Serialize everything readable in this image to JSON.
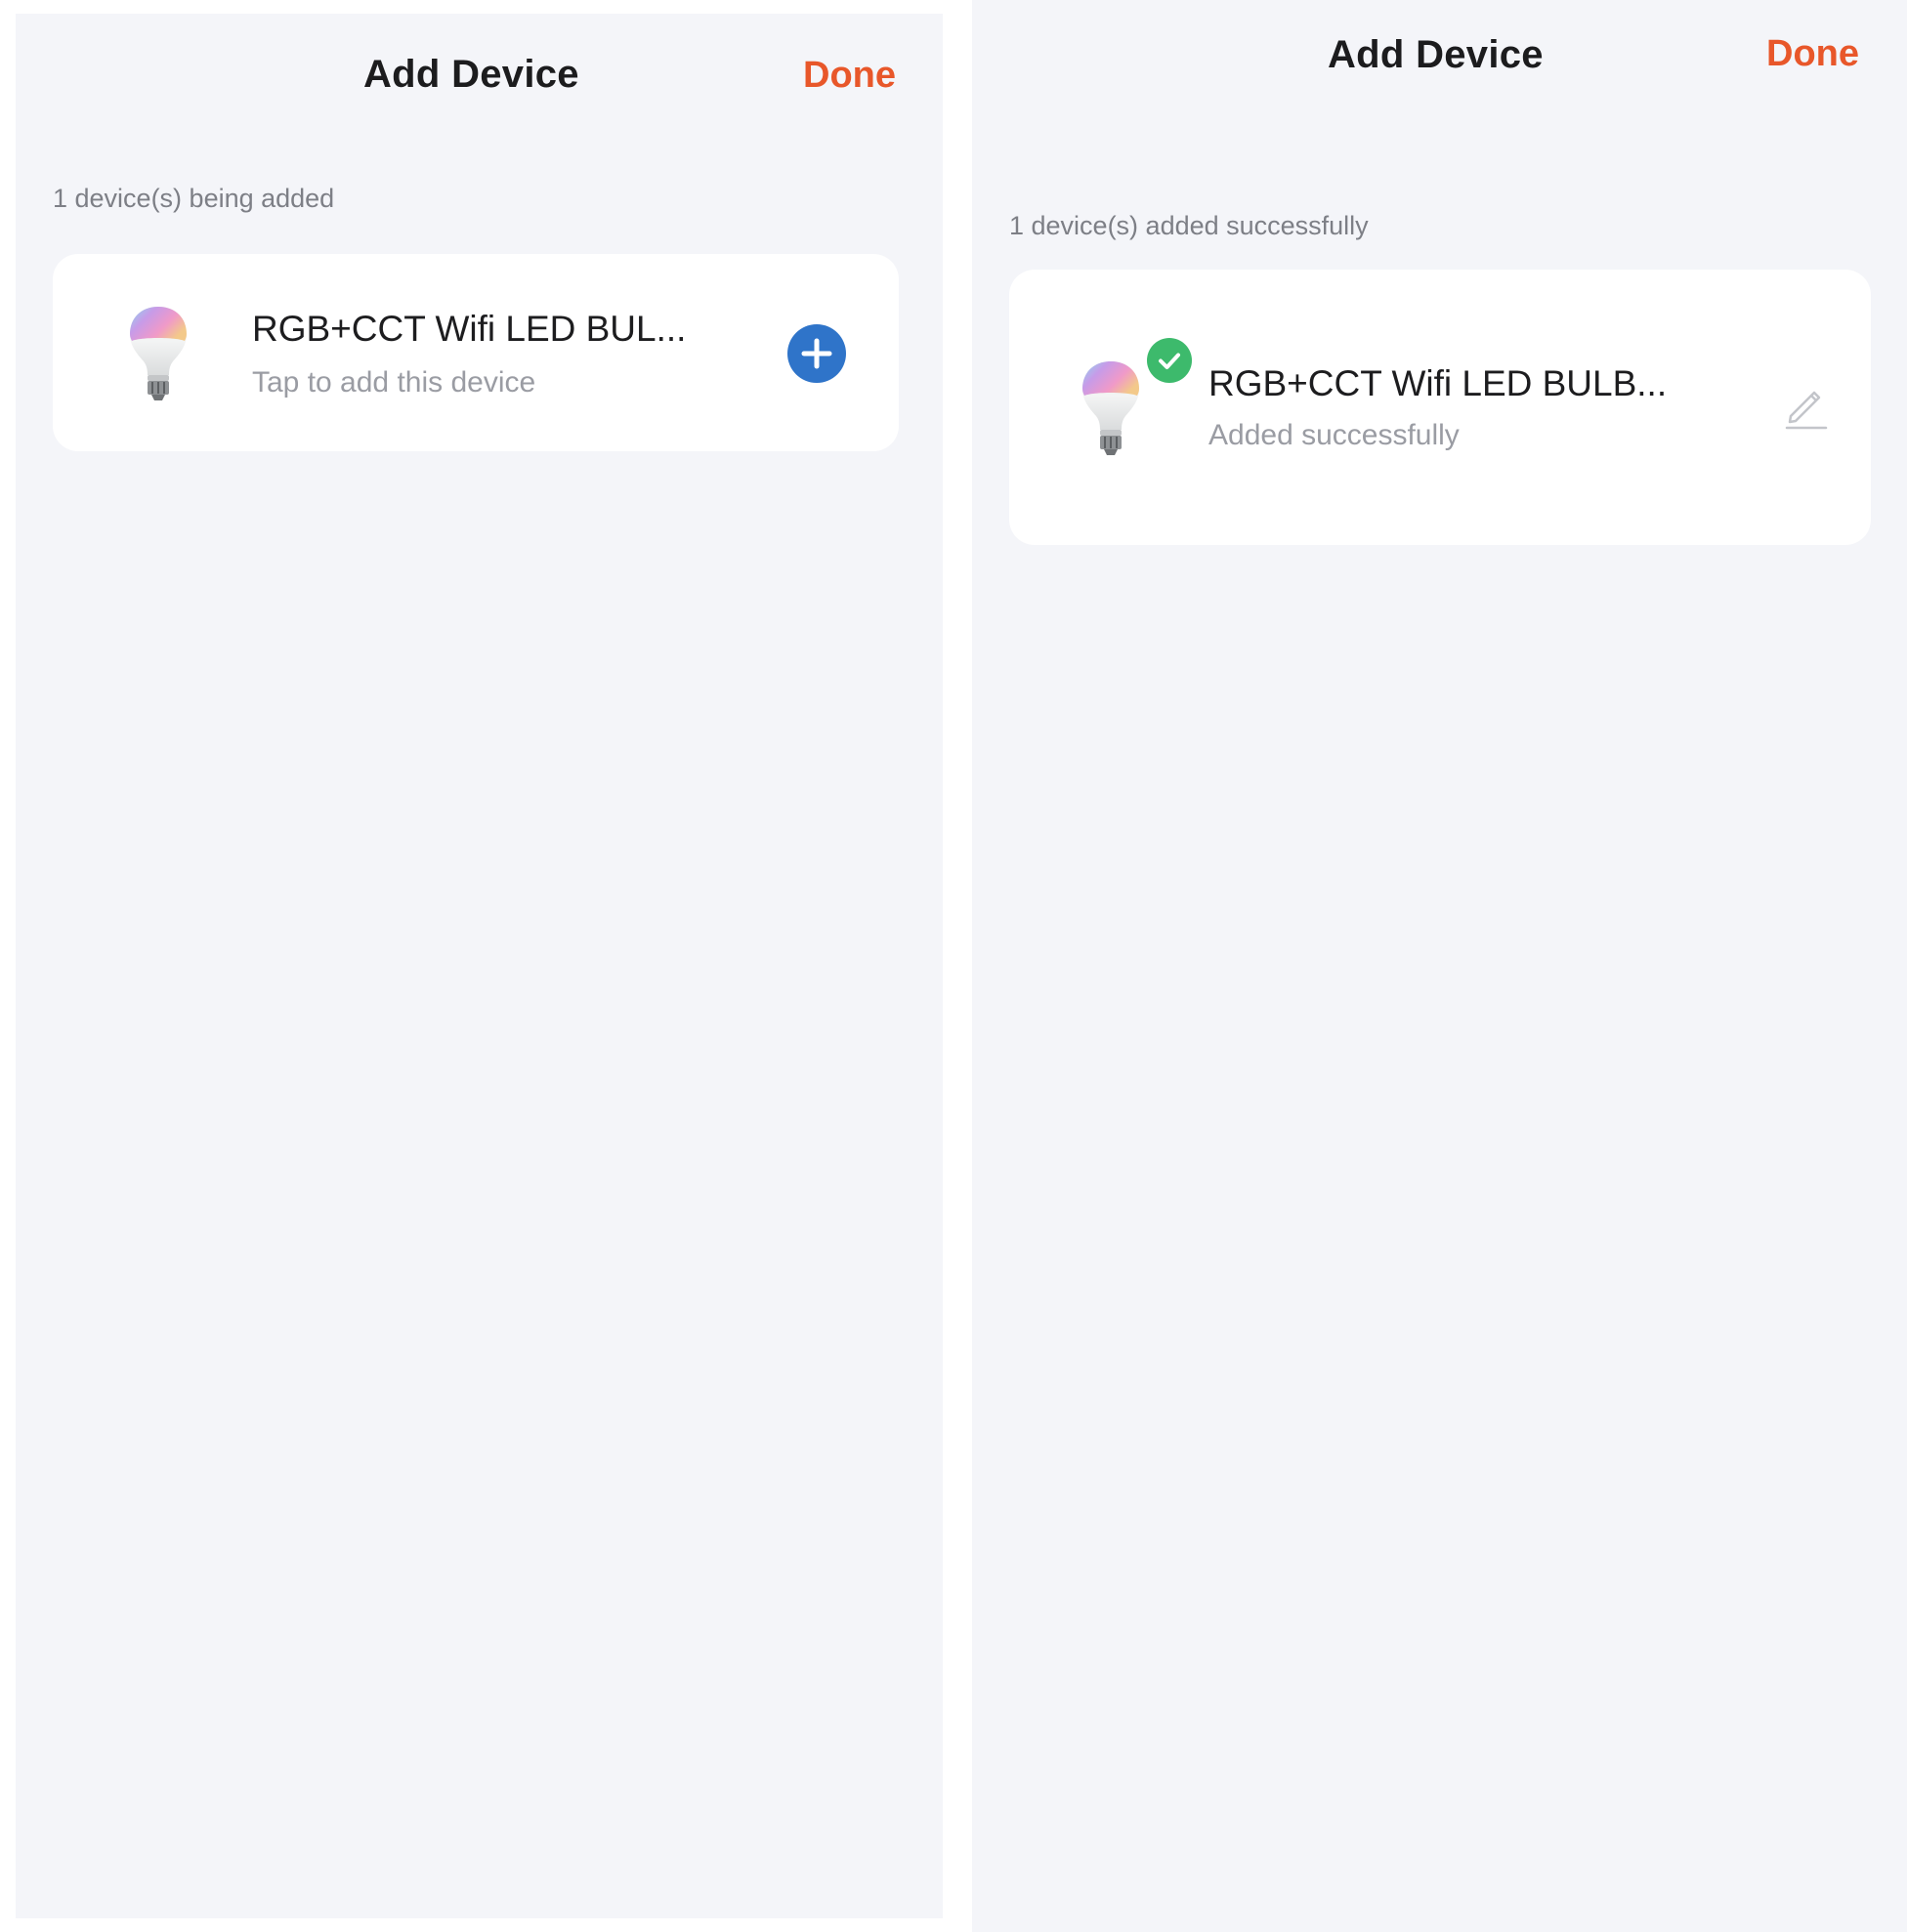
{
  "left_screen": {
    "title": "Add Device",
    "done_label": "Done",
    "section_label": "1 device(s) being added",
    "device": {
      "name": "RGB+CCT Wifi LED BUL...",
      "subtitle": "Tap to add this device",
      "icon": "light-bulb-icon",
      "action_icon": "plus-icon"
    }
  },
  "right_screen": {
    "title": "Add Device",
    "done_label": "Done",
    "section_label": "1 device(s) added successfully",
    "device": {
      "name": "RGB+CCT Wifi LED BULB...",
      "subtitle": "Added successfully",
      "icon": "light-bulb-icon",
      "status_icon": "checkmark-icon",
      "action_icon": "pencil-icon"
    }
  },
  "colors": {
    "background": "#f4f5f9",
    "card": "#ffffff",
    "accent_done": "#e8572a",
    "add_button": "#2f74c9",
    "success_badge": "#3dba6c"
  }
}
